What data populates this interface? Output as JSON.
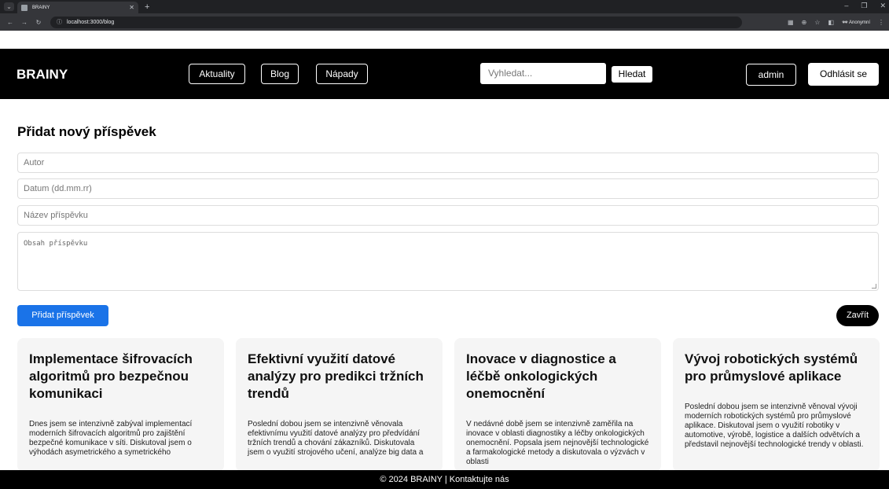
{
  "browser": {
    "tab_title": "BRAINY",
    "url": "localhost:3000/blog",
    "profile_label": "Anonymní"
  },
  "header": {
    "logo": "BRAINY",
    "nav": [
      "Aktuality",
      "Blog",
      "Nápady"
    ],
    "search_placeholder": "Vyhledat...",
    "search_button": "Hledat",
    "user_button": "admin",
    "logout_button": "Odhlásit se"
  },
  "form": {
    "title": "Přidat nový příspěvek",
    "author_placeholder": "Autor",
    "date_placeholder": "Datum (dd.mm.rr)",
    "post_title_placeholder": "Název příspěvku",
    "content_placeholder": "Obsah příspěvku",
    "submit_label": "Přidat příspěvek",
    "close_label": "Zavřít"
  },
  "posts": [
    {
      "title": "Implementace šifrovacích algoritmů pro bezpečnou komunikaci",
      "excerpt": "Dnes jsem se intenzivně zabýval implementací moderních šifrovacích algoritmů pro zajištění bezpečné komunikace v síti. Diskutoval jsem o výhodách asymetrického a symetrického"
    },
    {
      "title": "Efektivní využití datové analýzy pro predikci tržních trendů",
      "excerpt": "Poslední dobou jsem se intenzivně věnovala efektivnímu využití datové analýzy pro předvídání tržních trendů a chování zákazníků. Diskutovala jsem o využití strojového učení, analýze big data a"
    },
    {
      "title": "Inovace v diagnostice a léčbě onkologických onemocnění",
      "excerpt": "V nedávné době jsem se intenzivně zaměřila na inovace v oblasti diagnostiky a léčby onkologických onemocnění. Popsala jsem nejnovější technologické a farmakologické metody a diskutovala o výzvách v oblasti"
    },
    {
      "title": "Vývoj robotických systémů pro průmyslové aplikace",
      "excerpt": "Poslední dobou jsem se intenzivně věnoval vývoji moderních robotických systémů pro průmyslové aplikace. Diskutoval jsem o využití robotiky v automotive, výrobě, logistice a dalších odvětvích a představil nejnovější technologické trendy v oblasti."
    }
  ],
  "footer": {
    "text": "© 2024 BRAINY | Kontaktujte nás"
  }
}
